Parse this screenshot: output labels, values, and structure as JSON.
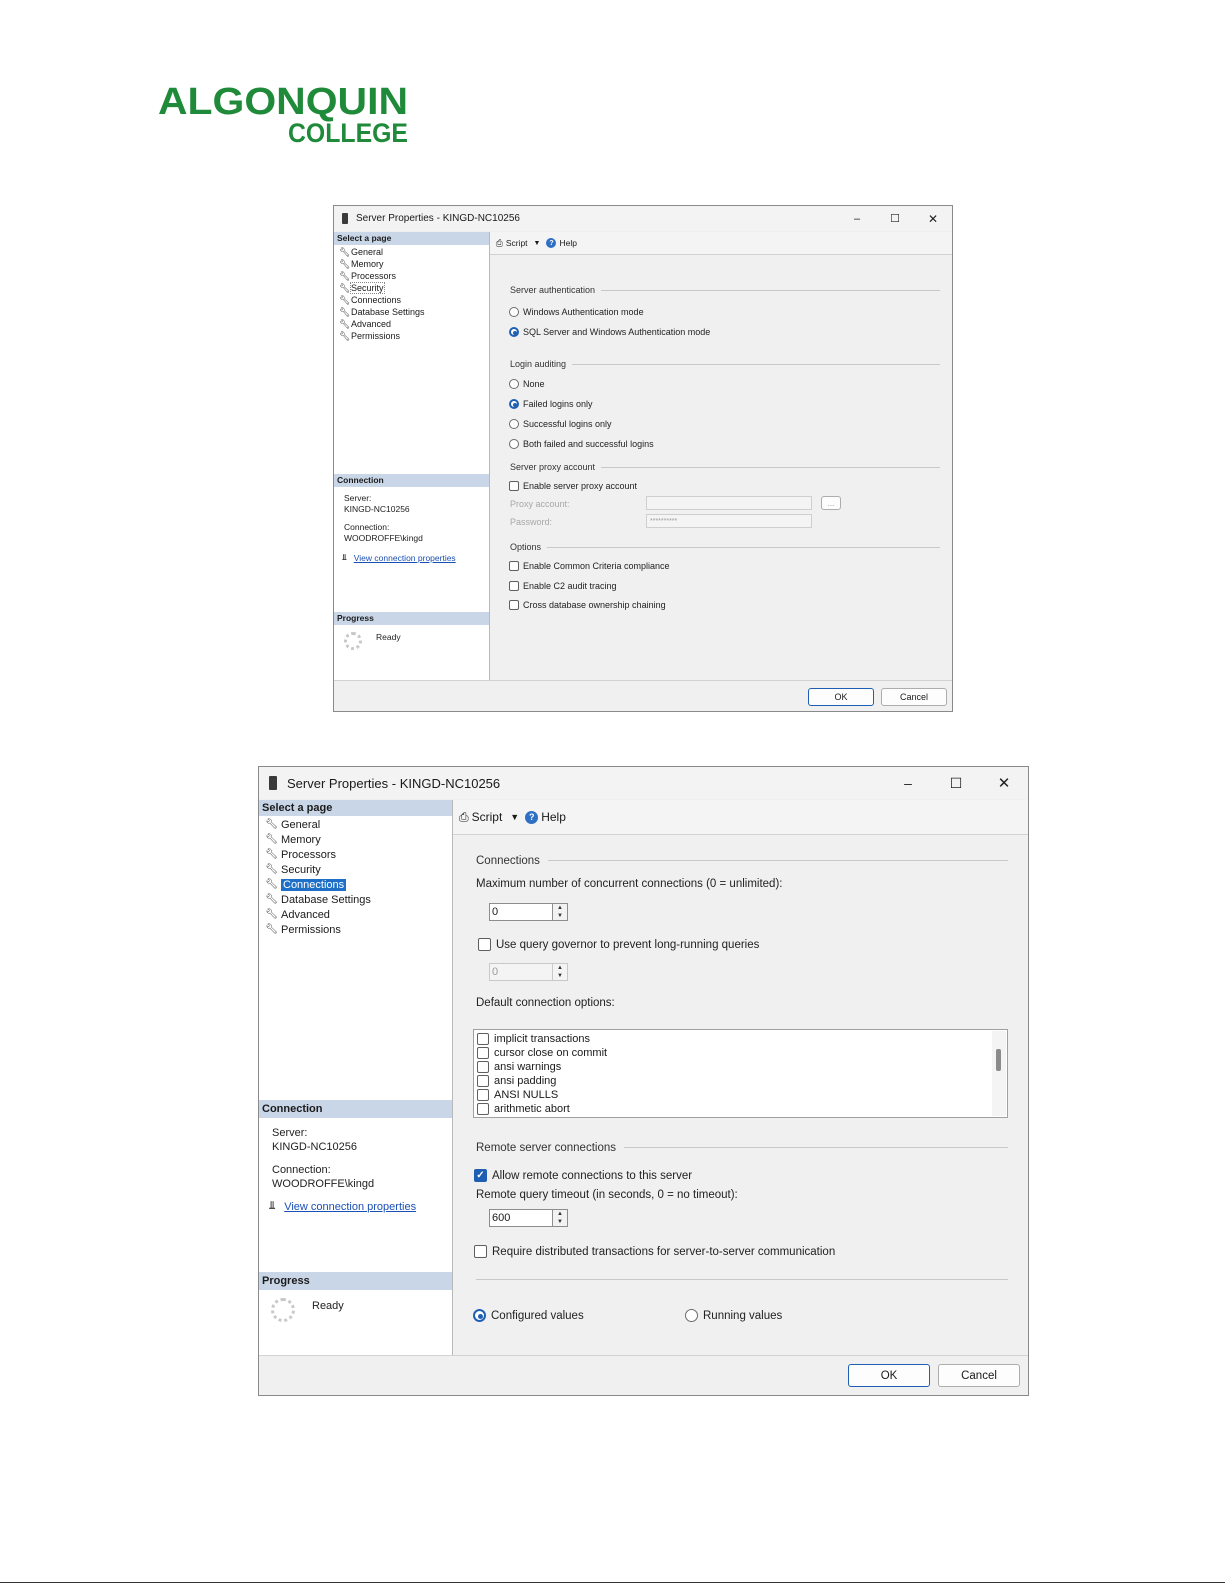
{
  "logo": {
    "line1": "ALGONQUIN",
    "line2": "COLLEGE",
    "color": "#1f8a3a"
  },
  "dialog1": {
    "title": "Server Properties - KINGD-NC10256",
    "select_page_header": "Select a page",
    "pages": [
      "General",
      "Memory",
      "Processors",
      "Security",
      "Connections",
      "Database Settings",
      "Advanced",
      "Permissions"
    ],
    "toolbar": {
      "script_label": "Script",
      "help_label": "Help"
    },
    "server_authentication": {
      "group_label": "Server authentication",
      "options": [
        {
          "label": "Windows Authentication mode",
          "selected": false
        },
        {
          "label": "SQL Server and Windows Authentication mode",
          "selected": true
        }
      ]
    },
    "login_auditing": {
      "group_label": "Login auditing",
      "options": [
        {
          "label": "None",
          "selected": false
        },
        {
          "label": "Failed logins only",
          "selected": true
        },
        {
          "label": "Successful logins only",
          "selected": false
        },
        {
          "label": "Both failed and successful logins",
          "selected": false
        }
      ]
    },
    "server_proxy": {
      "group_label": "Server proxy account",
      "enable_label": "Enable server proxy account",
      "proxy_account_label": "Proxy account:",
      "password_label": "Password:",
      "password_value": "**********",
      "browse_label": "..."
    },
    "options": {
      "group_label": "Options",
      "items": [
        {
          "label": "Enable Common Criteria compliance",
          "checked": false
        },
        {
          "label": "Enable C2 audit tracing",
          "checked": false
        },
        {
          "label": "Cross database ownership chaining",
          "checked": false
        }
      ]
    },
    "connection": {
      "header": "Connection",
      "server_label": "Server:",
      "server_value": "KINGD-NC10256",
      "connection_label": "Connection:",
      "connection_value": "WOODROFFE\\kingd",
      "view_link": "View connection properties"
    },
    "progress": {
      "header": "Progress",
      "status": "Ready"
    },
    "ok_label": "OK",
    "cancel_label": "Cancel"
  },
  "dialog2": {
    "title": "Server Properties - KINGD-NC10256",
    "select_page_header": "Select a page",
    "pages": [
      "General",
      "Memory",
      "Processors",
      "Security",
      "Connections",
      "Database Settings",
      "Advanced",
      "Permissions"
    ],
    "selected_page": "Connections",
    "toolbar": {
      "script_label": "Script",
      "help_label": "Help"
    },
    "connections": {
      "group_label": "Connections",
      "max_label": "Maximum number of concurrent connections (0 = unlimited):",
      "max_value": "0",
      "governor_label": "Use query governor to prevent long-running queries",
      "governor_checked": false,
      "governor_value": "0",
      "default_options_label": "Default connection options:",
      "default_options": [
        {
          "label": "implicit transactions",
          "checked": false
        },
        {
          "label": "cursor close on commit",
          "checked": false
        },
        {
          "label": "ansi warnings",
          "checked": false
        },
        {
          "label": "ansi padding",
          "checked": false
        },
        {
          "label": "ANSI NULLS",
          "checked": false
        },
        {
          "label": "arithmetic abort",
          "checked": false
        }
      ]
    },
    "remote": {
      "group_label": "Remote server connections",
      "allow_label": "Allow remote connections to this server",
      "allow_checked": true,
      "timeout_label": "Remote query timeout (in seconds, 0 = no timeout):",
      "timeout_value": "600",
      "distributed_label": "Require distributed transactions for server-to-server communication",
      "distributed_checked": false
    },
    "values_mode": {
      "configured_label": "Configured values",
      "configured_selected": true,
      "running_label": "Running values",
      "running_selected": false
    },
    "connection": {
      "header": "Connection",
      "server_label": "Server:",
      "server_value": "KINGD-NC10256",
      "connection_label": "Connection:",
      "connection_value": "WOODROFFE\\kingd",
      "view_link": "View connection properties"
    },
    "progress": {
      "header": "Progress",
      "status": "Ready"
    },
    "ok_label": "OK",
    "cancel_label": "Cancel"
  },
  "icons": {
    "wrench": "wrench-icon",
    "help": "help-icon",
    "script": "script-icon",
    "connection": "connection-properties-icon",
    "progress": "progress-spinner-icon"
  }
}
